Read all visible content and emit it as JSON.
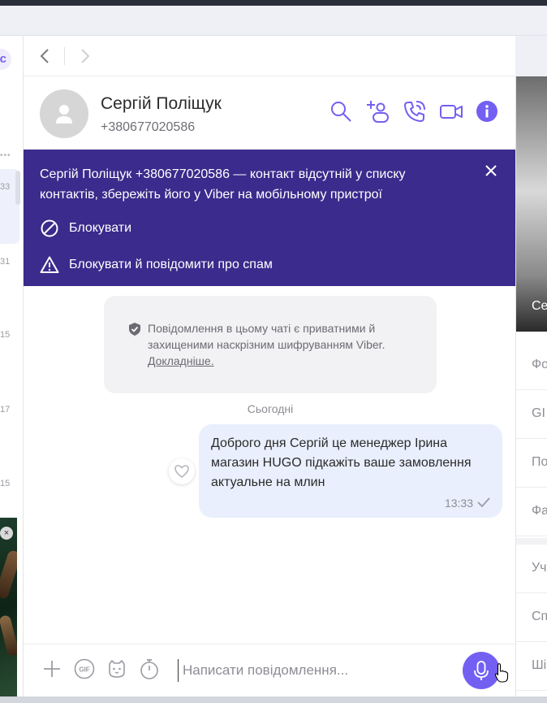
{
  "left_list": {
    "times": [
      "33",
      "31",
      "15",
      "17",
      "15"
    ],
    "ad_close": "×"
  },
  "header": {
    "name": "Сергій Поліщук",
    "phone": "+380677020586"
  },
  "banner": {
    "text": "Сергій Поліщук +380677020586 — контакт відсутній у списку контактів, збережіть його у Viber на мобільному пристрої",
    "block": "Блокувати",
    "block_report": "Блокувати й повідомити про спам"
  },
  "privacy": {
    "text": "Повідомлення в цьому чаті є приватними й захищеними наскрізним шифруванням Viber.",
    "link": "Докладніше."
  },
  "date_separator": "Сьогодні",
  "message": {
    "text": "Доброго дня Сергій це менеджер Ірина магазин HUGO підкажіть ваше замовлення актуальне на млин",
    "time": "13:33"
  },
  "composer": {
    "placeholder": "Написати повідомлення..."
  },
  "right_panel": {
    "photo_label": "Се",
    "items": [
      "Фо",
      "GI",
      "По",
      "Фа",
      "Уч",
      "Сп",
      "Ші"
    ]
  },
  "colors": {
    "accent": "#7360f2",
    "banner": "#3a2b8c",
    "bubble": "#e9effc"
  }
}
